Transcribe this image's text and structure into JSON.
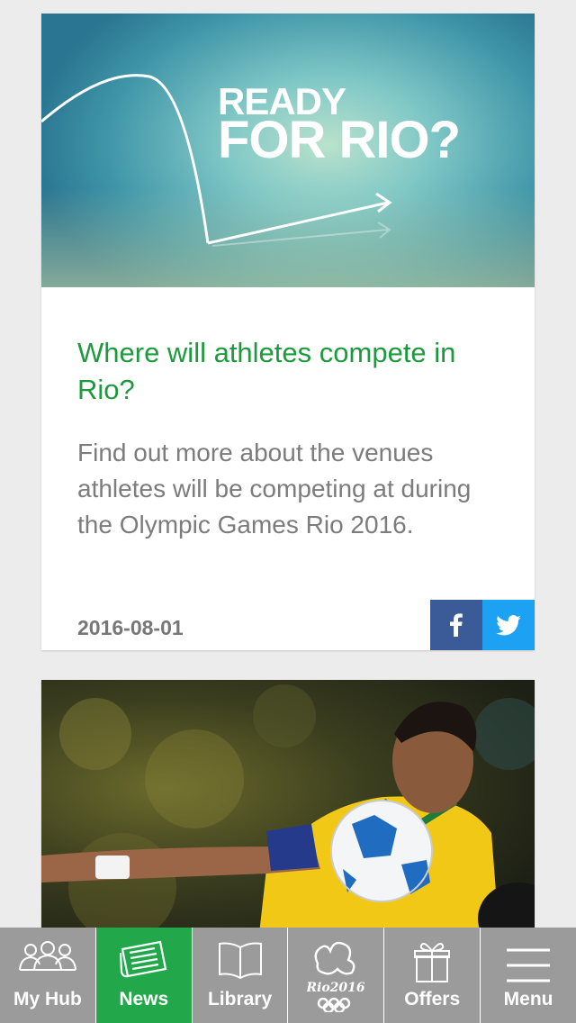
{
  "articles": [
    {
      "hero_text_line1": "READY",
      "hero_text_line2": "FOR RIO?",
      "title": "Where will athletes compete in Rio?",
      "summary": "Find out more about the venues athletes will be competing at during the Olympic Games Rio 2016.",
      "date": "2016-08-01",
      "share": [
        "facebook-icon",
        "twitter-icon"
      ]
    },
    {
      "image": "football-player-photo"
    }
  ],
  "tabbar": {
    "tabs": [
      {
        "label": "My Hub",
        "icon": "people-icon",
        "active": false
      },
      {
        "label": "News",
        "icon": "newspaper-icon",
        "active": true
      },
      {
        "label": "Library",
        "icon": "book-icon",
        "active": false
      },
      {
        "label": "",
        "icon": "rio2016-logo-icon",
        "active": false
      },
      {
        "label": "Offers",
        "icon": "gift-icon",
        "active": false
      },
      {
        "label": "Menu",
        "icon": "hamburger-menu-icon",
        "active": false
      }
    ],
    "rio_logo_text": "Rio2016"
  },
  "colors": {
    "accent": "#22a84a",
    "headline": "#1d9a3e",
    "facebook": "#3b5a98",
    "twitter": "#1da1f2",
    "tabbar": "#9b9b9b"
  }
}
